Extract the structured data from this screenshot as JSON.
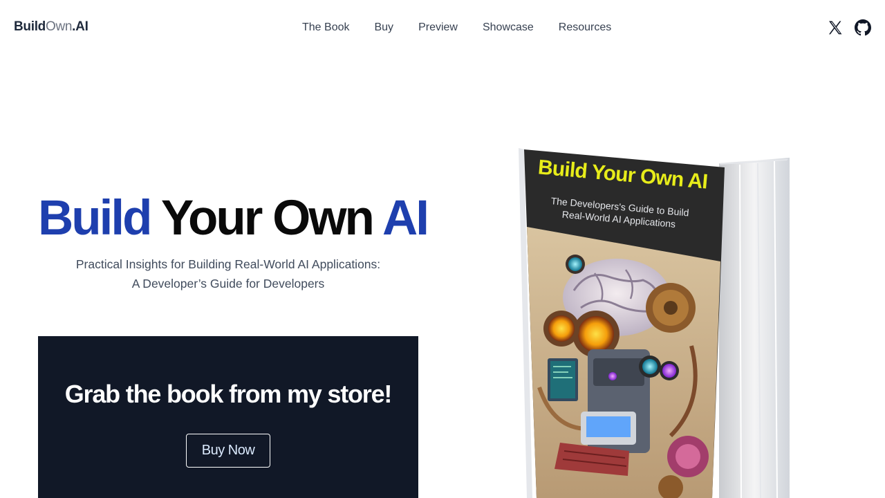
{
  "logo": {
    "part1": "Build",
    "part2": "Own",
    "part3": ".AI"
  },
  "nav": [
    {
      "label": "The Book"
    },
    {
      "label": "Buy"
    },
    {
      "label": "Preview"
    },
    {
      "label": "Showcase"
    },
    {
      "label": "Resources"
    }
  ],
  "social": {
    "x_icon": "x-logo-icon",
    "github_icon": "github-icon"
  },
  "hero": {
    "title_word1": "Build",
    "title_word2": "Your Own",
    "title_word3": "AI",
    "subtitle_line1": "Practical Insights for Building Real-World AI Applications:",
    "subtitle_line2": "A Developer’s Guide for Developers"
  },
  "cta": {
    "heading": "Grab the book from my store!",
    "button_label": "Buy Now"
  },
  "book": {
    "title": "Build Your Own AI",
    "subtitle_line1": "The Developers's Guide to Build",
    "subtitle_line2": "Real-World AI Applications"
  },
  "colors": {
    "brand_blue": "#1e3fae",
    "cta_bg": "#111827",
    "cover_title": "#e7ec1a"
  }
}
